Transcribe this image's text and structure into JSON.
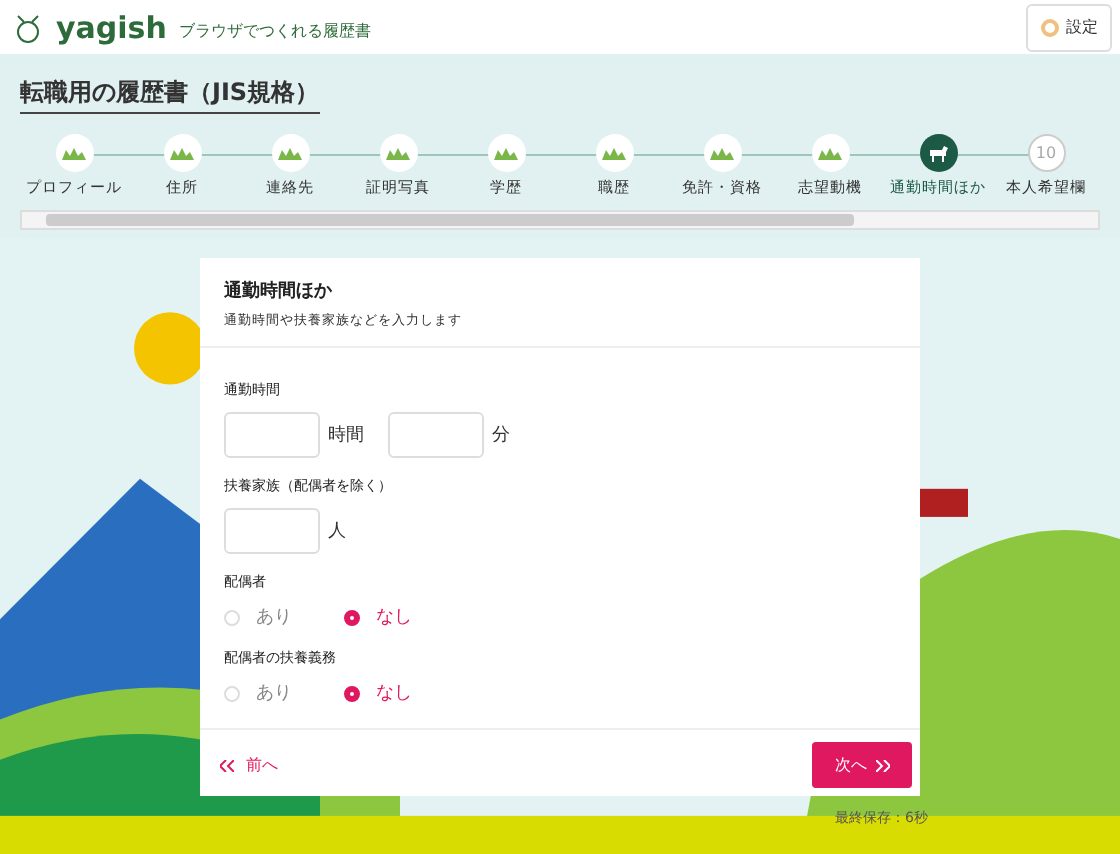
{
  "header": {
    "logo": "yagish",
    "tagline": "ブラウザでつくれる履歴書",
    "settings_button": "設定"
  },
  "page_title": "転職用の履歴書（JIS規格）",
  "steps": [
    {
      "label": "プロフィール",
      "kind": "done",
      "selected": false
    },
    {
      "label": "住所",
      "kind": "done",
      "selected": false
    },
    {
      "label": "連絡先",
      "kind": "done",
      "selected": false
    },
    {
      "label": "証明写真",
      "kind": "done",
      "selected": false
    },
    {
      "label": "学歴",
      "kind": "done",
      "selected": false
    },
    {
      "label": "職歴",
      "kind": "done",
      "selected": false
    },
    {
      "label": "免許・資格",
      "kind": "done",
      "selected": false
    },
    {
      "label": "志望動機",
      "kind": "done",
      "selected": false
    },
    {
      "label": "通勤時間ほか",
      "kind": "current",
      "selected": true
    },
    {
      "label": "本人希望欄",
      "kind": "number",
      "number": "10",
      "selected": false
    }
  ],
  "form": {
    "title": "通勤時間ほか",
    "subtitle": "通勤時間や扶養家族などを入力します",
    "fields": [
      {
        "kind": "inputs",
        "label": "通勤時間",
        "inputs": [
          {
            "unit": "時間"
          },
          {
            "unit": "分"
          }
        ]
      },
      {
        "kind": "inputs",
        "label": "扶養家族（配偶者を除く）",
        "inputs": [
          {
            "unit": "人"
          }
        ]
      },
      {
        "kind": "radio",
        "label": "配偶者",
        "options": [
          {
            "label": "あり",
            "selected": false
          },
          {
            "label": "なし",
            "selected": true
          }
        ]
      },
      {
        "kind": "radio",
        "label": "配偶者の扶養義務",
        "options": [
          {
            "label": "あり",
            "selected": false
          },
          {
            "label": "なし",
            "selected": true
          }
        ]
      }
    ],
    "prev_button": "前へ",
    "next_button": "次へ"
  },
  "save_status": "最終保存：6秒"
}
